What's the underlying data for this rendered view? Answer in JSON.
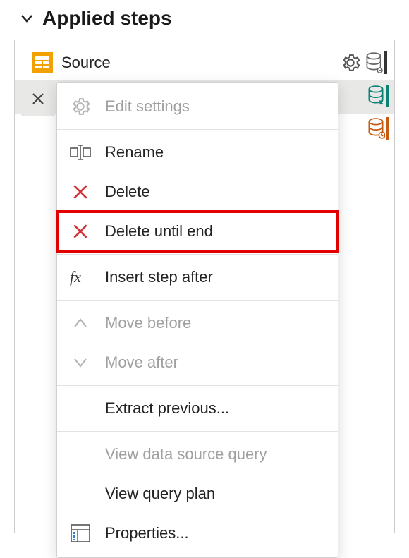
{
  "header": {
    "title": "Applied steps"
  },
  "steps": [
    {
      "label": "Source"
    }
  ],
  "menu": {
    "edit_settings": "Edit settings",
    "rename": "Rename",
    "delete": "Delete",
    "delete_until_end": "Delete until end",
    "insert_step_after": "Insert step after",
    "move_before": "Move before",
    "move_after": "Move after",
    "extract_previous": "Extract previous...",
    "view_data_source_query": "View data source query",
    "view_query_plan": "View query plan",
    "properties": "Properties..."
  }
}
